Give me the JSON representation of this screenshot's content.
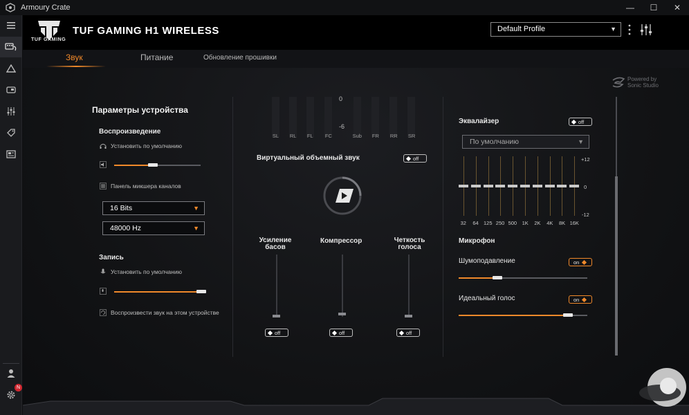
{
  "window": {
    "title": "Armoury Crate",
    "minimize": "—",
    "maximize": "☐",
    "close": "✕"
  },
  "header": {
    "brand": "TUF GAMING",
    "product": "TUF GAMING H1 WIRELESS",
    "profile": "Default Profile"
  },
  "tabs": [
    {
      "label": "Звук"
    },
    {
      "label": "Питание"
    },
    {
      "label": "Обновление прошивки"
    }
  ],
  "sonic": {
    "line1": "Powered by",
    "line2": "Sonic Studio"
  },
  "device": {
    "title": "Параметры устройства",
    "playback": {
      "title": "Воспроизведение",
      "set_default": "Установить по умолчанию",
      "volume": 0.45,
      "mixer": "Панель микшера каналов",
      "bits": "16 Bits",
      "rate": "48000 Hz"
    },
    "record": {
      "title": "Запись",
      "set_default": "Установить по умолчанию",
      "volume": 0.95,
      "playback_on_device": "Воспроизвести звук на этом устройстве"
    }
  },
  "channels": {
    "scale_top": "0",
    "scale_bottom": "-6",
    "labels": [
      "SL",
      "RL",
      "FL",
      "FC",
      "Sub",
      "FR",
      "RR",
      "SR"
    ]
  },
  "virtual_surround": {
    "title": "Виртуальный объемный звук",
    "toggle": "off"
  },
  "effects": [
    {
      "title": "Усиление басов",
      "toggle": "off",
      "level": 0
    },
    {
      "title": "Компрессор",
      "toggle": "off",
      "level": 0
    },
    {
      "title": "Четкость голоса",
      "toggle": "off",
      "level": 0
    }
  ],
  "equalizer": {
    "title": "Эквалайзер",
    "toggle": "off",
    "preset": "По умолчанию",
    "scale": {
      "top": "+12",
      "mid": "0",
      "bottom": "-12"
    },
    "bands": [
      {
        "label": "32",
        "gain": 0
      },
      {
        "label": "64",
        "gain": 0
      },
      {
        "label": "125",
        "gain": 0
      },
      {
        "label": "250",
        "gain": 0
      },
      {
        "label": "500",
        "gain": 0
      },
      {
        "label": "1K",
        "gain": 0
      },
      {
        "label": "2K",
        "gain": 0
      },
      {
        "label": "4K",
        "gain": 0
      },
      {
        "label": "8K",
        "gain": 0
      },
      {
        "label": "16K",
        "gain": 0
      }
    ]
  },
  "mic": {
    "title": "Микрофон",
    "noise": {
      "label": "Шумоподавление",
      "toggle": "on",
      "level": 0.3
    },
    "perfect_voice": {
      "label": "Идеальный голос",
      "toggle": "on",
      "level": 0.85
    }
  },
  "nav": {
    "badge": "N"
  },
  "colors": {
    "accent": "#f0892a",
    "background": "#0d0e10"
  }
}
